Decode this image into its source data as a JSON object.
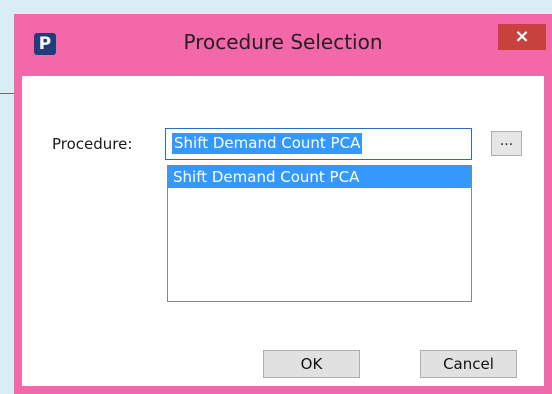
{
  "dialog": {
    "title": "Procedure Selection",
    "icon_letter": "P",
    "close_glyph": "×"
  },
  "form": {
    "procedure_label": "Procedure:",
    "procedure_value": "Shift Demand Count PCA",
    "browse_label": "...",
    "list_items": [
      "Shift Demand Count PCA"
    ]
  },
  "buttons": {
    "ok": "OK",
    "cancel": "Cancel"
  },
  "colors": {
    "frame": "#f268a9",
    "close": "#c9413f",
    "selection": "#3399ff",
    "background": "#d9edf5"
  },
  "icons": {
    "app": "app-logo-icon",
    "close": "close-icon"
  }
}
